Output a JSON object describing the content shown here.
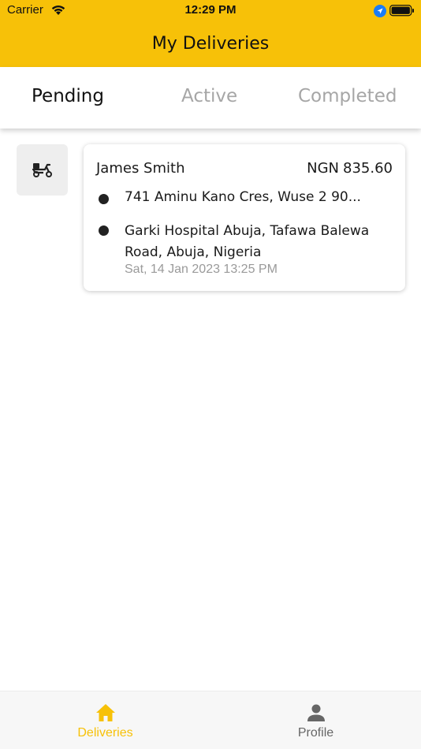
{
  "status_bar": {
    "carrier": "Carrier",
    "time": "12:29 PM"
  },
  "header": {
    "title": "My Deliveries",
    "color": "#F7C108"
  },
  "tabs": [
    {
      "label": "Pending",
      "selected": true
    },
    {
      "label": "Active",
      "selected": false
    },
    {
      "label": "Completed",
      "selected": false
    }
  ],
  "deliveries": [
    {
      "icon": "scooter-icon",
      "customer": "James Smith",
      "currency": "NGN",
      "amount": "835.60",
      "pickup": "741 Aminu Kano Cres, Wuse 2 90...",
      "dropoff": "Garki Hospital Abuja, Tafawa Balewa Road, Abuja, Nigeria",
      "datetime": "Sat, 14 Jan 2023 13:25 PM"
    }
  ],
  "bottom_nav": [
    {
      "label": "Deliveries",
      "icon": "home-icon",
      "active": true
    },
    {
      "label": "Profile",
      "icon": "person-icon",
      "active": false
    }
  ]
}
